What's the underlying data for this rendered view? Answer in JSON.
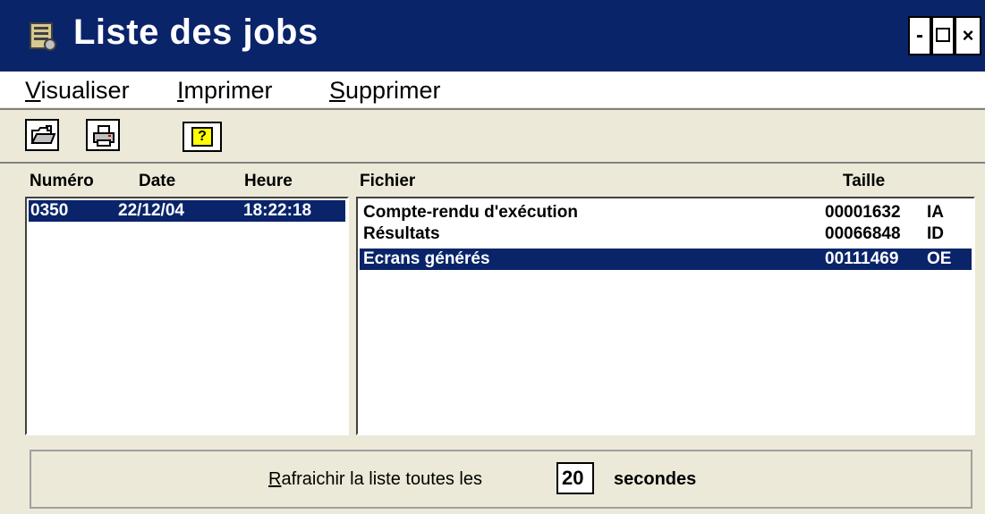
{
  "window": {
    "title": "Liste des jobs"
  },
  "menu": {
    "visualiser": {
      "accel": "V",
      "rest": "isualiser"
    },
    "imprimer": {
      "accel": "I",
      "rest": "mprimer"
    },
    "supprimer": {
      "accel": "S",
      "rest": "upprimer"
    }
  },
  "toolbar": {
    "buttons": [
      "open-icon",
      "print-icon",
      "help-icon"
    ],
    "help_glyph": "?"
  },
  "jobs": {
    "headers": {
      "numero": "Numéro",
      "date": "Date",
      "heure": "Heure"
    },
    "rows": [
      {
        "numero": "0350",
        "date": "22/12/04",
        "heure": "18:22:18",
        "selected": true
      }
    ]
  },
  "files": {
    "headers": {
      "fichier": "Fichier",
      "taille": "Taille"
    },
    "rows": [
      {
        "fichier": "Compte-rendu d'exécution",
        "taille": "00001632",
        "code": "IA",
        "selected": false
      },
      {
        "fichier": "Résultats",
        "taille": "00066848",
        "code": "ID",
        "selected": false
      },
      {
        "fichier": "Ecrans générés",
        "taille": "00111469",
        "code": "OE",
        "selected": true
      }
    ]
  },
  "refresh": {
    "label_accel": "R",
    "label_rest": "afraichir la liste toutes les",
    "value": "20",
    "unit": "secondes"
  },
  "colors": {
    "titlebar": "#0a246a",
    "selection": "#0a246a",
    "background": "#ece9d8"
  }
}
